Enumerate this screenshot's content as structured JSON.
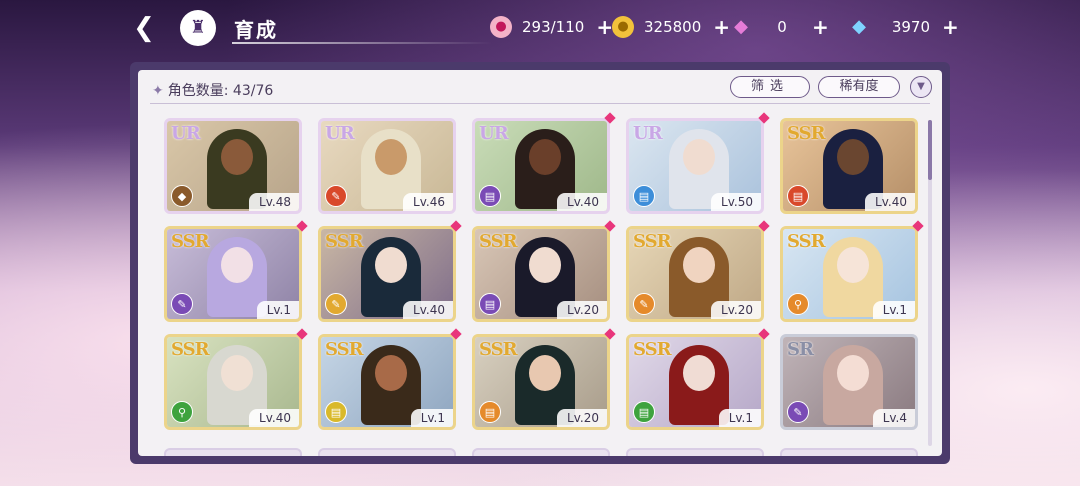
{
  "header": {
    "title": "育成",
    "back_icon": "back-arrow-icon",
    "home_icon": "castle-icon"
  },
  "currencies": [
    {
      "name": "candy",
      "icon": "candy-icon",
      "value": "293/110"
    },
    {
      "name": "coin",
      "icon": "coin-icon",
      "value": "325800"
    },
    {
      "name": "pink-gem",
      "icon": "pink-diamond-icon",
      "value": "0"
    },
    {
      "name": "blue-gem",
      "icon": "blue-diamond-icon",
      "value": "3970"
    }
  ],
  "panel": {
    "count_label": "角色数量:",
    "count_value": "43/76",
    "filter_label": "筛选",
    "rarity_label": "稀有度",
    "sort_icon": "sort-toggle-icon"
  },
  "colors": {
    "ur": "#c9a7e6",
    "ssr": "#e2a930",
    "sr": "#8a8fa6",
    "new_marker": "#e8367b"
  },
  "cards": [
    {
      "rarity": "UR",
      "level": "Lv.48",
      "element": "shield",
      "elem_color": "#8a5a2b",
      "new": false
    },
    {
      "rarity": "UR",
      "level": "Lv.46",
      "element": "brush",
      "elem_color": "#d9492b",
      "new": false
    },
    {
      "rarity": "UR",
      "level": "Lv.40",
      "element": "scroll",
      "elem_color": "#7a4bb5",
      "new": true
    },
    {
      "rarity": "UR",
      "level": "Lv.50",
      "element": "scroll",
      "elem_color": "#3d8ed9",
      "new": true
    },
    {
      "rarity": "SSR",
      "level": "Lv.40",
      "element": "scroll",
      "elem_color": "#d9492b",
      "new": false
    },
    {
      "rarity": "SSR",
      "level": "Lv.1",
      "element": "brush",
      "elem_color": "#7a4bb5",
      "new": true
    },
    {
      "rarity": "SSR",
      "level": "Lv.40",
      "element": "brush",
      "elem_color": "#e2a930",
      "new": true
    },
    {
      "rarity": "SSR",
      "level": "Lv.20",
      "element": "scroll",
      "elem_color": "#7a4bb5",
      "new": true
    },
    {
      "rarity": "SSR",
      "level": "Lv.20",
      "element": "brush",
      "elem_color": "#e58a2b",
      "new": true
    },
    {
      "rarity": "SSR",
      "level": "Lv.1",
      "element": "key",
      "elem_color": "#e58a2b",
      "new": true
    },
    {
      "rarity": "SSR",
      "level": "Lv.40",
      "element": "key",
      "elem_color": "#3ea33e",
      "new": true
    },
    {
      "rarity": "SSR",
      "level": "Lv.1",
      "element": "scroll",
      "elem_color": "#d9b92b",
      "new": true
    },
    {
      "rarity": "SSR",
      "level": "Lv.20",
      "element": "scroll",
      "elem_color": "#e58a2b",
      "new": true
    },
    {
      "rarity": "SSR",
      "level": "Lv.1",
      "element": "scroll",
      "elem_color": "#3ea33e",
      "new": true
    },
    {
      "rarity": "SR",
      "level": "Lv.4",
      "element": "brush",
      "elem_color": "#7a4bb5",
      "new": false
    }
  ]
}
